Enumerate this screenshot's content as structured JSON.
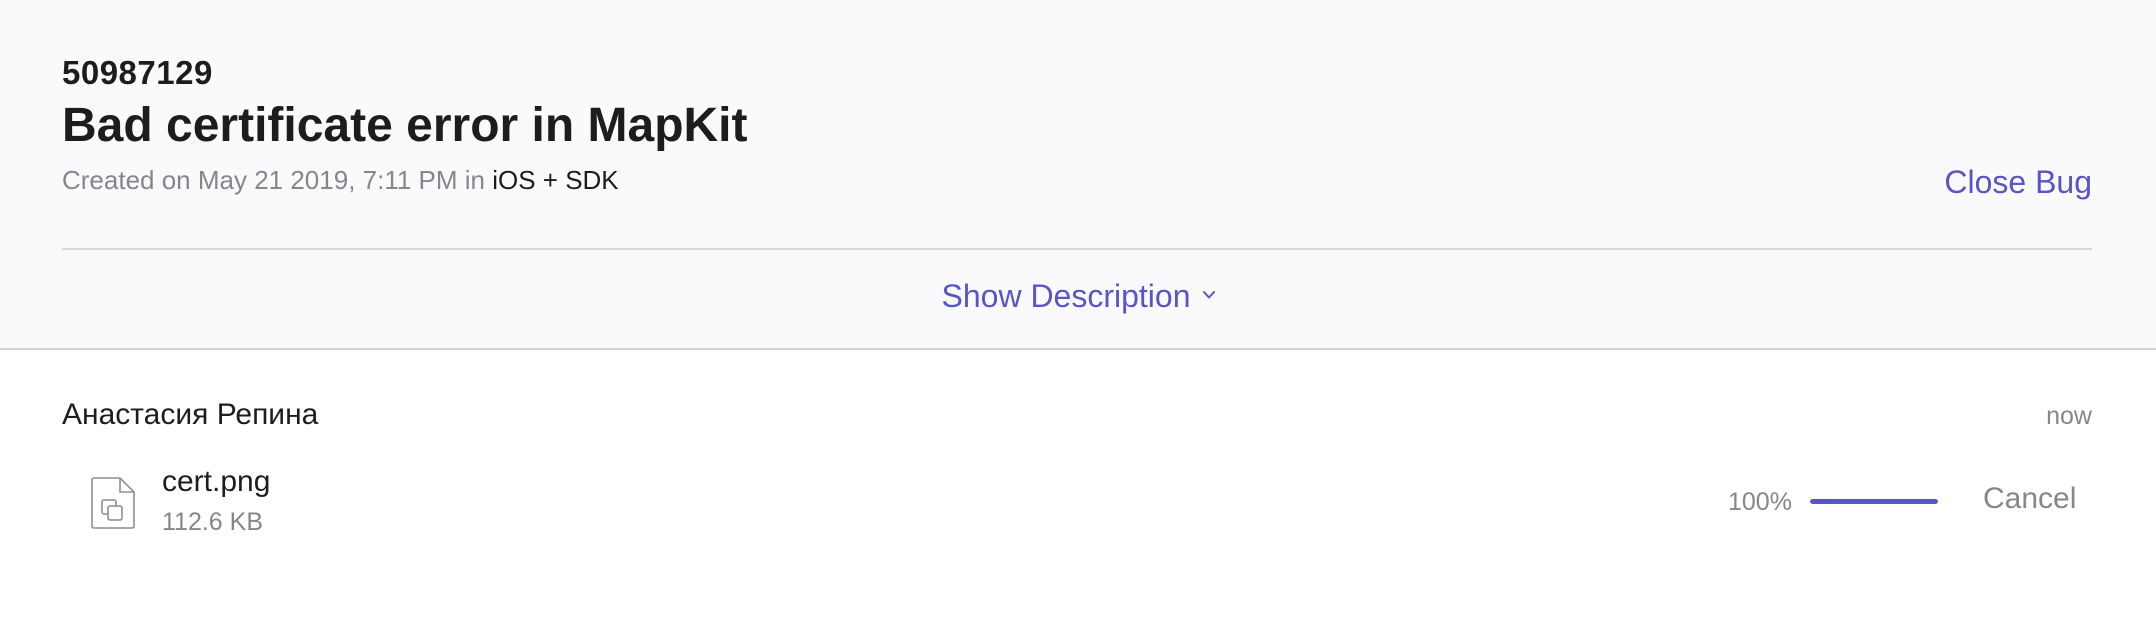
{
  "bug": {
    "id": "50987129",
    "title": "Bad certificate error in MapKit",
    "created_prefix": "Created on May 21 2019, 7:11 PM in ",
    "component": "iOS + SDK",
    "close_label": "Close Bug",
    "show_description_label": "Show Description"
  },
  "comment": {
    "author": "Анастасия Репина",
    "time": "now",
    "attachment": {
      "name": "cert.png",
      "size": "112.6 KB",
      "progress_label": "100%",
      "progress_value": 1.0,
      "cancel_label": "Cancel"
    }
  },
  "colors": {
    "accent": "#5856c7",
    "secondary_text": "#86868b",
    "primary_text": "#1d1d1f",
    "header_bg": "#fafafc"
  },
  "icons": {
    "attachment": "document-icon",
    "expand": "chevron-down-icon"
  }
}
